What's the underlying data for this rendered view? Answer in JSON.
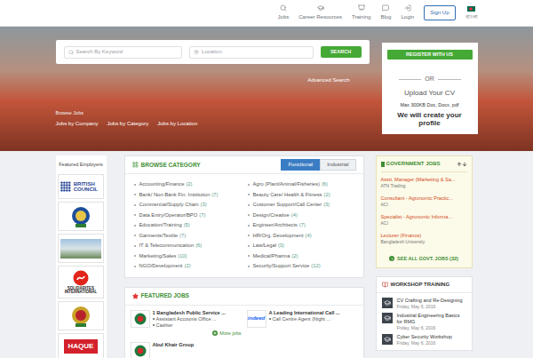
{
  "nav": {
    "items": [
      {
        "label": "Jobs"
      },
      {
        "label": "Career Resources"
      },
      {
        "label": "Training"
      },
      {
        "label": "Blog"
      },
      {
        "label": "Login"
      }
    ],
    "signup": "Sign Up",
    "language": "বাংলা"
  },
  "hero": {
    "keyword_placeholder": "Search By Keyword",
    "location_placeholder": "Location",
    "search_button": "SEARCH",
    "advanced": "Advanced Search",
    "browse_label": "Browse Jobs",
    "links": [
      "Jobs by Company",
      "Jobs by Category",
      "Jobs by Location"
    ]
  },
  "register": {
    "button": "REGISTER WITH US",
    "or": "OR",
    "upload": "Upload Your CV",
    "limit": "Max 300KB Doc, Docx, pdf",
    "note": "We will create your profile"
  },
  "featured_employers": {
    "title": "Featured Employers",
    "logos": [
      {
        "kind": "british",
        "text": "BRITISH COUNCIL"
      },
      {
        "kind": "crest",
        "text": ""
      },
      {
        "kind": "photo",
        "text": ""
      },
      {
        "kind": "solidarites",
        "text": "SOLIDARITES INTERNATIONAL"
      },
      {
        "kind": "badge",
        "text": ""
      },
      {
        "kind": "haque",
        "text": "HAQUE"
      }
    ]
  },
  "browse": {
    "title": "BROWSE CATEGORY",
    "toggle": [
      {
        "label": "Functional",
        "selected": true
      },
      {
        "label": "Industrial",
        "selected": false
      }
    ],
    "columns": [
      [
        {
          "name": "Accounting/Finance",
          "count": "(2)"
        },
        {
          "name": "Bank/ Non-Bank Fin. Institution",
          "count": "(7)"
        },
        {
          "name": "Commercial/Supply Chain",
          "count": "(3)"
        },
        {
          "name": "Data Entry/Operator/BPO",
          "count": "(7)"
        },
        {
          "name": "Education/Training",
          "count": "(5)"
        },
        {
          "name": "Garments/Textile",
          "count": "(7)"
        },
        {
          "name": "IT & Telecommunication",
          "count": "(6)"
        },
        {
          "name": "Marketing/Sales",
          "count": "(10)"
        },
        {
          "name": "NGO/Development",
          "count": "(2)"
        }
      ],
      [
        {
          "name": "Agro (Plant/Animal/Fisheries)",
          "count": "(6)"
        },
        {
          "name": "Beauty Care/ Health & Fitness",
          "count": "(2)"
        },
        {
          "name": "Customer Support/Call Center",
          "count": "(3)"
        },
        {
          "name": "Design/Creative",
          "count": "(4)"
        },
        {
          "name": "Engineer/Architects",
          "count": "(7)"
        },
        {
          "name": "HR/Org. Development",
          "count": "(4)"
        },
        {
          "name": "Law/Legal",
          "count": "(3)"
        },
        {
          "name": "Medical/Pharma",
          "count": "(2)"
        },
        {
          "name": "Security/Support Service",
          "count": "(12)"
        }
      ]
    ]
  },
  "featured_jobs": {
    "title": "FEATURED JOBS",
    "items": [
      {
        "company": "1 Bangladesh Public Service ...",
        "logo": "seal",
        "logo_text": "",
        "jobs": [
          "Assistant Accounts Office ...",
          "Cashier"
        ],
        "more": "More jobs"
      },
      {
        "company": "A Leading International Call ...",
        "logo": "indeed",
        "logo_text": "indeed",
        "jobs": [
          "Call Centre Agent (Night ..."
        ],
        "more": ""
      },
      {
        "company": "Abul Khair Group",
        "logo": "seal",
        "logo_text": "",
        "jobs": [],
        "more": ""
      }
    ]
  },
  "government_jobs": {
    "title": "GOVERNMENT JOBS",
    "items": [
      {
        "title": "Asstt. Manager (Marketing & Sa...",
        "company": "ATN Trading"
      },
      {
        "title": "Consultant - Agronomic Practic...",
        "company": "ACI"
      },
      {
        "title": "Specialist - Agronomic Informa...",
        "company": "ACI"
      },
      {
        "title": "Lecturer (Finance)",
        "company": "Bangladesh University"
      }
    ],
    "see_all": "SEE ALL GOVT. JOBS (32)"
  },
  "workshop": {
    "title": "WORKSHOP TRAINING",
    "items": [
      {
        "title": "CV Crafting and Re-Designing",
        "date": "Friday, May 6, 2016"
      },
      {
        "title": "Industrial Engineering Basics for RMG",
        "date": "Friday, May 6, 2016"
      },
      {
        "title": "Cyber Security Workshop",
        "date": "Friday, May 6, 2016"
      }
    ]
  }
}
